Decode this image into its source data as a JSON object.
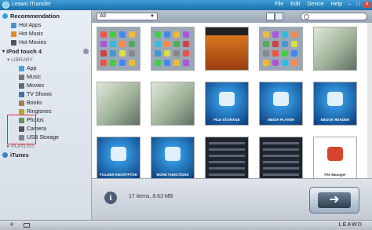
{
  "window": {
    "title": "Leawo iTransfer"
  },
  "menu": [
    "File",
    "Edit",
    "Device",
    "Help"
  ],
  "window_controls": [
    "–",
    "□",
    "×"
  ],
  "sidebar": {
    "recommendation": {
      "label": "Recommendation",
      "items": [
        "Hot Apps",
        "Hot Music",
        "Hot Movies"
      ]
    },
    "device": {
      "label": "iPod touch 4"
    },
    "library": {
      "label": "LIBRARY",
      "items": [
        "App",
        "Music",
        "Movies",
        "TV Shows",
        "Books",
        "Ringtones",
        "Photos",
        "Camera",
        "USB Storage"
      ]
    },
    "playlist": {
      "label": "PLAYLIST"
    },
    "itunes": {
      "label": "iTunes"
    }
  },
  "toolbar": {
    "filter_value": "All"
  },
  "thumbnails": [
    {
      "kind": "ios"
    },
    {
      "kind": "ios"
    },
    {
      "kind": "video"
    },
    {
      "kind": "ios"
    },
    {
      "kind": "office"
    },
    {
      "kind": "office"
    },
    {
      "kind": "office"
    },
    {
      "kind": "app",
      "label": "FILE STORAGE"
    },
    {
      "kind": "app",
      "label": "MEDIA PLAYER"
    },
    {
      "kind": "app",
      "label": "EBOOK READER"
    },
    {
      "kind": "app",
      "label": "FOLDER ENCRYPTOR"
    },
    {
      "kind": "app",
      "label": "MORE FUNCTIONS"
    },
    {
      "kind": "list"
    },
    {
      "kind": "list"
    },
    {
      "kind": "app",
      "label": "File Manager"
    }
  ],
  "info": {
    "items_text": "17 items, 8.63 MB"
  },
  "footer": {
    "brand": "LEAWO"
  },
  "colors": {
    "titlebar": "#1d6fa8",
    "highlight_box": "#e03030",
    "app_blue": "#0a3a78"
  }
}
